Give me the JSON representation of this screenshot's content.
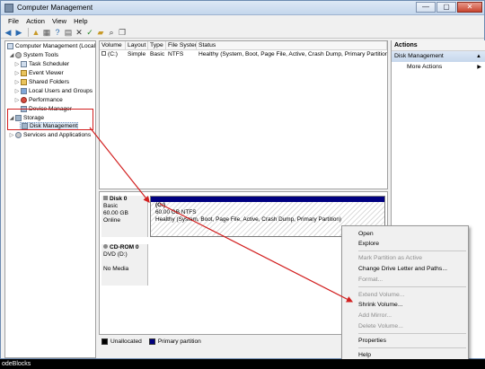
{
  "window": {
    "title": "Computer Management",
    "controls": {
      "minimize": "—",
      "maximize": "▢",
      "close": "✕"
    }
  },
  "menu": [
    "File",
    "Action",
    "View",
    "Help"
  ],
  "toolbar": {
    "icons": [
      "back-arrow-icon",
      "forward-arrow-icon",
      "up-folder-icon",
      "show-hide-tree-icon",
      "help-icon",
      "properties-icon",
      "close-x-icon",
      "check-icon",
      "open-folder-icon",
      "search-icon",
      "pages-icon"
    ]
  },
  "tree": {
    "root": "Computer Management (Local",
    "system_tools": "System Tools",
    "task_scheduler": "Task Scheduler",
    "event_viewer": "Event Viewer",
    "shared_folders": "Shared Folders",
    "local_users": "Local Users and Groups",
    "performance": "Performance",
    "device_manager": "Device Manager",
    "storage": "Storage",
    "disk_management": "Disk Management",
    "services": "Services and Applications"
  },
  "volume_list": {
    "headers": [
      "Volume",
      "Layout",
      "Type",
      "File System",
      "Status"
    ],
    "rows": [
      [
        "(C:)",
        "Simple",
        "Basic",
        "NTFS",
        "Healthy (System, Boot, Page File, Active, Crash Dump, Primary Partition"
      ]
    ]
  },
  "disks": {
    "disk0": {
      "name": "Disk 0",
      "type": "Basic",
      "size": "60.00 GB",
      "status": "Online",
      "partition": {
        "label": "(C:)",
        "size_fs": "60.00 GB NTFS",
        "health": "Healthy (System, Boot, Page File, Active, Crash Dump, Primary Partition)"
      }
    },
    "cdrom0": {
      "name": "CD-ROM 0",
      "type": "DVD (D:)",
      "status": "No Media"
    }
  },
  "legend": {
    "unallocated": "Unallocated",
    "primary": "Primary partition",
    "colors": {
      "unallocated": "#000000",
      "primary": "#000080"
    }
  },
  "actions": {
    "title": "Actions",
    "section": "Disk Management",
    "more": "More Actions"
  },
  "context_menu": {
    "items": [
      {
        "label": "Open",
        "enabled": true
      },
      {
        "label": "Explore",
        "enabled": true
      },
      {
        "label": "Mark Partition as Active",
        "enabled": false
      },
      {
        "label": "Change Drive Letter and Paths...",
        "enabled": true
      },
      {
        "label": "Format...",
        "enabled": false
      },
      {
        "label": "Extend Volume...",
        "enabled": false
      },
      {
        "label": "Shrink Volume...",
        "enabled": true
      },
      {
        "label": "Add Mirror...",
        "enabled": false
      },
      {
        "label": "Delete Volume...",
        "enabled": false
      },
      {
        "label": "Properties",
        "enabled": true
      },
      {
        "label": "Help",
        "enabled": true
      }
    ]
  },
  "annotation_color": "#d21f1f",
  "taskbar_fragment": "odeBlocks"
}
